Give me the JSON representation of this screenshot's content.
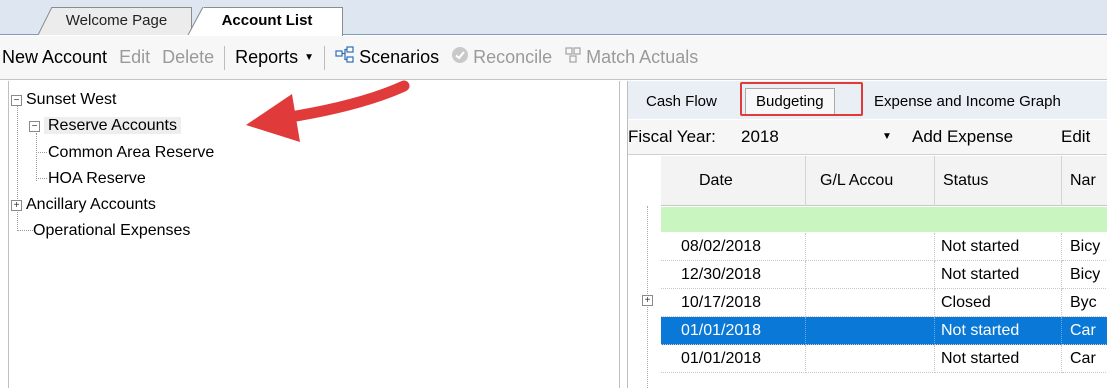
{
  "doc_tabs": {
    "welcome": "Welcome Page",
    "active": "Account List"
  },
  "toolbar": {
    "new_account": "New Account",
    "edit": "Edit",
    "delete": "Delete",
    "reports": "Reports",
    "scenarios": "Scenarios",
    "reconcile": "Reconcile",
    "match_actuals": "Match Actuals"
  },
  "tree": {
    "root": "Sunset West",
    "reserve_accounts": "Reserve Accounts",
    "common_area_reserve": "Common Area Reserve",
    "hoa_reserve": "HOA Reserve",
    "ancillary_accounts": "Ancillary Accounts",
    "operational_expenses": "Operational Expenses"
  },
  "sub_tabs": {
    "cash_flow": "Cash Flow",
    "budgeting": "Budgeting",
    "graphs": "Expense and Income Graph"
  },
  "fiscal_bar": {
    "label": "Fiscal Year:",
    "year": "2018",
    "add_expense": "Add Expense",
    "edit": "Edit"
  },
  "grid": {
    "columns": [
      "Date",
      "G/L Accou",
      "Status",
      "Nar"
    ],
    "rows": [
      {
        "date": "08/02/2018",
        "gl": "",
        "status": "Not started",
        "name": "Bicy"
      },
      {
        "date": "12/30/2018",
        "gl": "",
        "status": "Not started",
        "name": "Bicy"
      },
      {
        "date": "10/17/2018",
        "gl": "",
        "status": "Closed",
        "name": "Byc"
      },
      {
        "date": "01/01/2018",
        "gl": "",
        "status": "Not started",
        "name": "Car"
      },
      {
        "date": "01/01/2018",
        "gl": "",
        "status": "Not started",
        "name": "Car"
      }
    ]
  },
  "colors": {
    "selection_blue": "#0a78d6",
    "new_row_green": "#c9f5c0",
    "annotation_red": "#e03a3a"
  }
}
